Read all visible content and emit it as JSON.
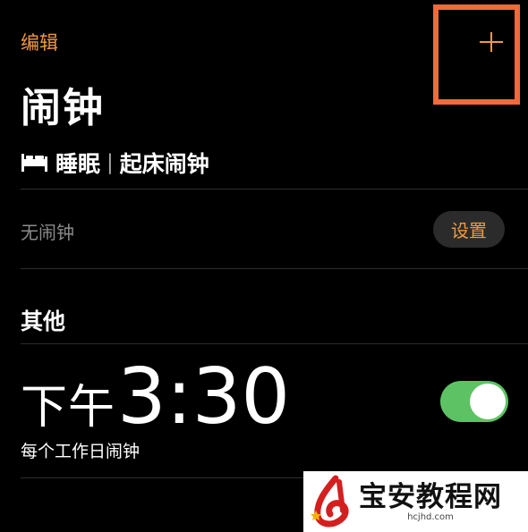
{
  "header": {
    "edit_label": "编辑",
    "add_icon": "plus-icon"
  },
  "title": "闹钟",
  "sleep": {
    "bed_icon": "bed-icon",
    "sleep_label": "睡眠",
    "separator": "|",
    "wake_label": "起床闹钟"
  },
  "sleep_status": {
    "no_alarm_label": "无闹钟",
    "setup_label": "设置"
  },
  "other_section": {
    "heading": "其他"
  },
  "alarm": {
    "period": "下午",
    "time": "3:30",
    "repeat": "每个工作日闹钟",
    "enabled": true
  },
  "watermark": {
    "title": "宝安教程网",
    "site": "hcjhd.com"
  },
  "colors": {
    "accent": "#f19a3e",
    "highlight": "#f06a3b",
    "toggle_on": "#5dc263",
    "background": "#000000"
  }
}
